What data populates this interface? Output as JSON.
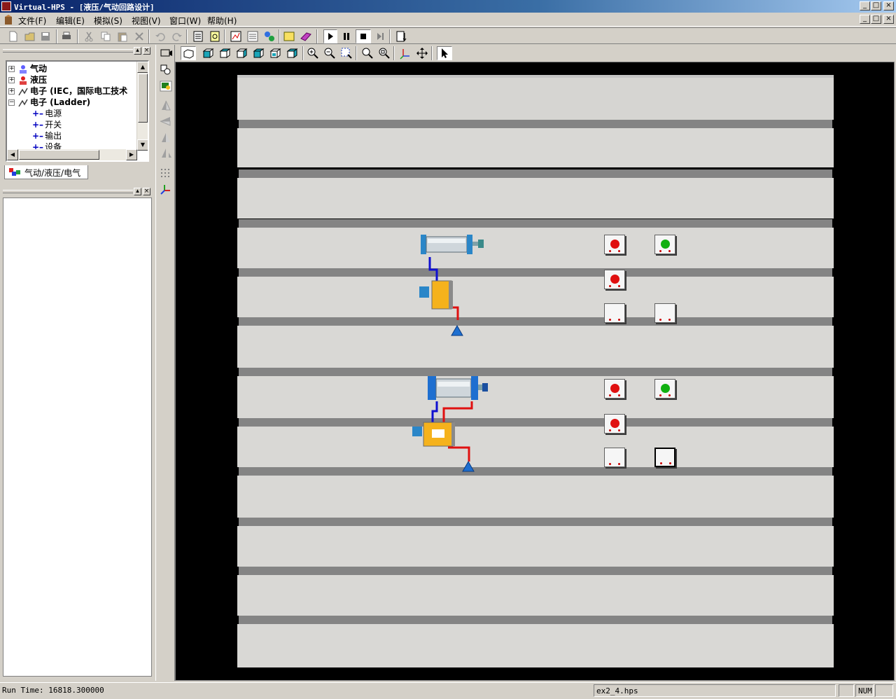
{
  "window": {
    "title": "Virtual-HPS - [液压/气动回路设计]"
  },
  "menu": {
    "items": [
      "文件(F)",
      "编辑(E)",
      "模拟(S)",
      "视图(V)",
      "窗口(W)",
      "帮助(H)"
    ]
  },
  "tree": {
    "items": [
      {
        "label": "气动",
        "expander": "+"
      },
      {
        "label": "液压",
        "expander": "+"
      },
      {
        "label": "电子 (IEC，国际电工技术",
        "expander": "+"
      },
      {
        "label": "电子 (Ladder)",
        "expander": "−"
      },
      {
        "label": "电源"
      },
      {
        "label": "开关"
      },
      {
        "label": "输出"
      },
      {
        "label": "设备"
      }
    ]
  },
  "tabs": {
    "active": "气动/液压/电气"
  },
  "status": {
    "run_time": "Run Time: 16818.300000",
    "file": "ex2_4.hps",
    "num": "NUM"
  },
  "colors": {
    "led_red": "#e01010",
    "led_green": "#10b010",
    "pipe_blue": "#1010d0",
    "pipe_red": "#e01010",
    "valve_yellow": "#f5b21c",
    "tank_blue": "#1e6fd0"
  },
  "icons": [
    "new-icon",
    "open-icon",
    "save-icon",
    "print-icon",
    "cut-icon",
    "copy-icon",
    "paste-icon",
    "delete-icon",
    "undo-icon",
    "redo-icon",
    "play-icon",
    "pause-icon",
    "stop-icon",
    "step-icon"
  ]
}
